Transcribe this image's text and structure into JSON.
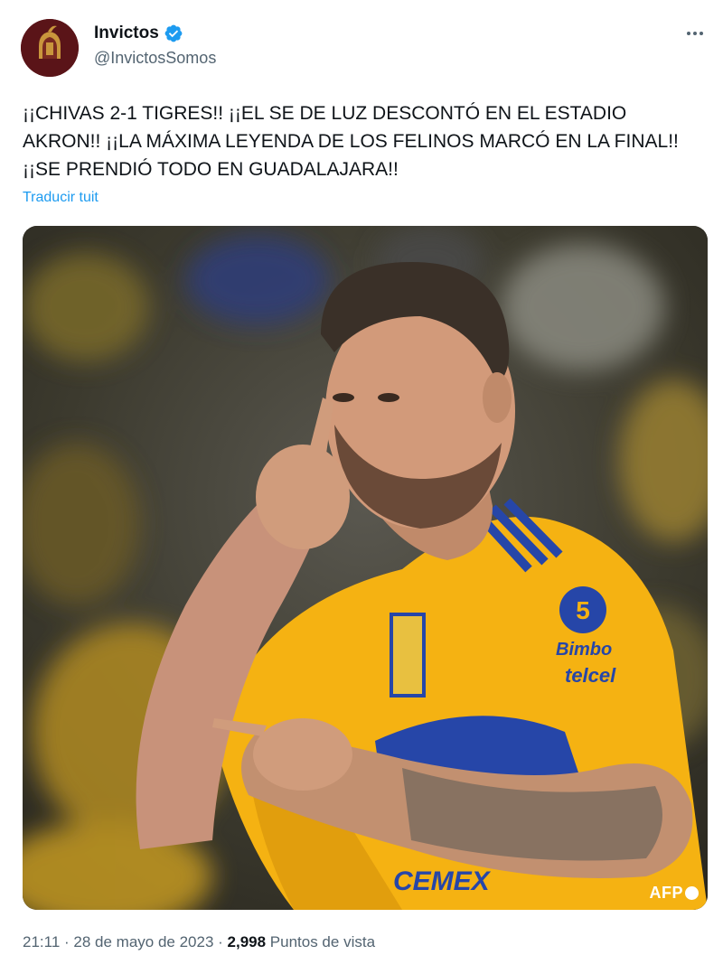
{
  "author": {
    "name": "Invictos",
    "handle": "@InvictosSomos",
    "verified": true,
    "avatar_icon": "helmet-logo-icon"
  },
  "tweet": {
    "lines": [
      "¡¡CHIVAS 2-1 TIGRES!! ¡¡EL SE DE LUZ DESCONTÓ EN EL ESTADIO",
      "AKRON!! ¡¡LA MÁXIMA LEYENDA DE LOS FELINOS MARCÓ EN LA FINAL!!",
      "¡¡SE PRENDIÓ TODO EN GUADALAJARA!!"
    ],
    "translate_label": "Traducir tuit"
  },
  "media": {
    "watermark": "AFP",
    "jersey_sponsor": "telcel",
    "jersey_brand": "Bimbo",
    "jersey_text": "CEMEX"
  },
  "meta": {
    "time": "21:11",
    "sep1": " · ",
    "date": "28 de mayo de 2023",
    "sep2": " · ",
    "views_count": "2,998",
    "views_label": " Puntos de vista"
  },
  "colors": {
    "link": "#1d9bf0",
    "secondary_text": "#536471",
    "verified": "#1d9bf0",
    "jersey_yellow": "#f5b212",
    "jersey_blue": "#2646a8"
  }
}
